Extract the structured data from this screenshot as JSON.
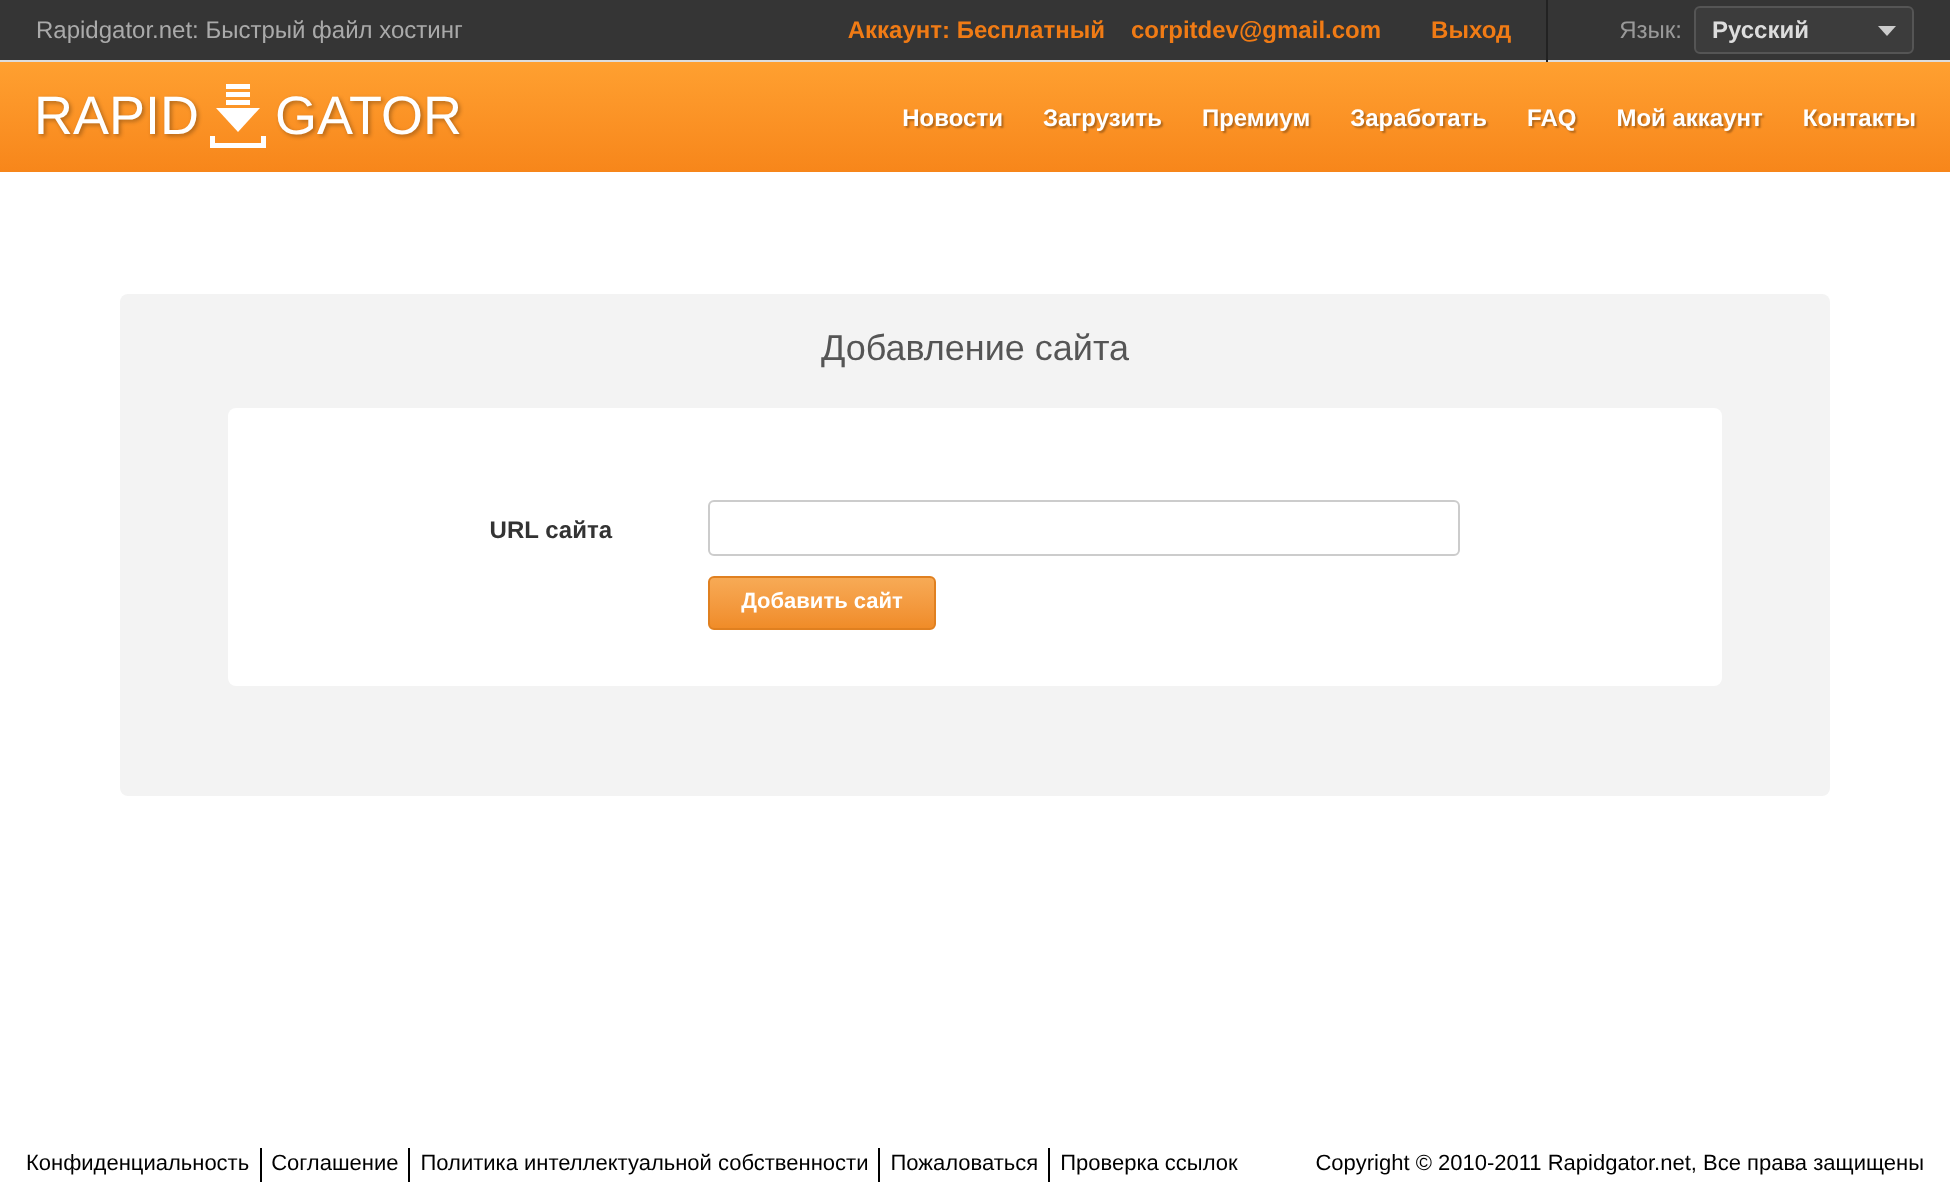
{
  "topbar": {
    "site_title": "Rapidgator.net: Быстрый файл хостинг",
    "account": "Аккаунт: Бесплатный",
    "email": "corpitdev@gmail.com",
    "logout": "Выход",
    "language_label": "Язык:",
    "language": "Русский"
  },
  "logo": {
    "left": "RAPID",
    "right": "GATOR"
  },
  "nav": [
    {
      "label": "Новости"
    },
    {
      "label": "Загрузить"
    },
    {
      "label": "Премиум"
    },
    {
      "label": "Заработать"
    },
    {
      "label": "FAQ"
    },
    {
      "label": "Мой аккаунт"
    },
    {
      "label": "Контакты"
    }
  ],
  "form": {
    "title": "Добавление сайта",
    "field_label": "URL сайта",
    "submit": "Добавить сайт"
  },
  "footer": {
    "links": [
      "Конфиденциальность",
      "Соглашение",
      "Политика интеллектуальной собственности",
      "Пожаловаться",
      "Проверка ссылок"
    ],
    "copyright": "Copyright © 2010-2011 Rapidgator.net, Все права защищены"
  }
}
